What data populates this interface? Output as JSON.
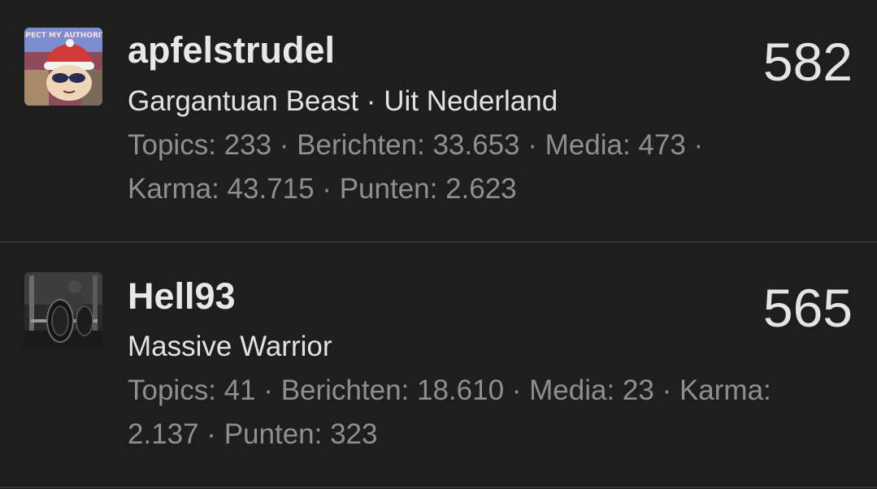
{
  "users": [
    {
      "username": "apfelstrudel",
      "subtitle": "Gargantuan Beast · Uit Nederland",
      "score": "582",
      "avatar_text": "RESPECT MY AUTHORITAH",
      "stats_line1": "Topics: 233 · Berichten: 33.653 · Media: 473 ·",
      "stats_line2": "Karma: 43.715 · Punten: 2.623"
    },
    {
      "username": "Hell93",
      "subtitle": "Massive Warrior",
      "score": "565",
      "stats_line1": "Topics: 41 · Berichten: 18.610 · Media: 23 · Karma:",
      "stats_line2": "2.137 · Punten: 323"
    }
  ],
  "colors": {
    "background": "#1e1e1e",
    "divider": "#353535",
    "primary_text": "#e6e6e6",
    "secondary_text": "#8f8f8f"
  }
}
